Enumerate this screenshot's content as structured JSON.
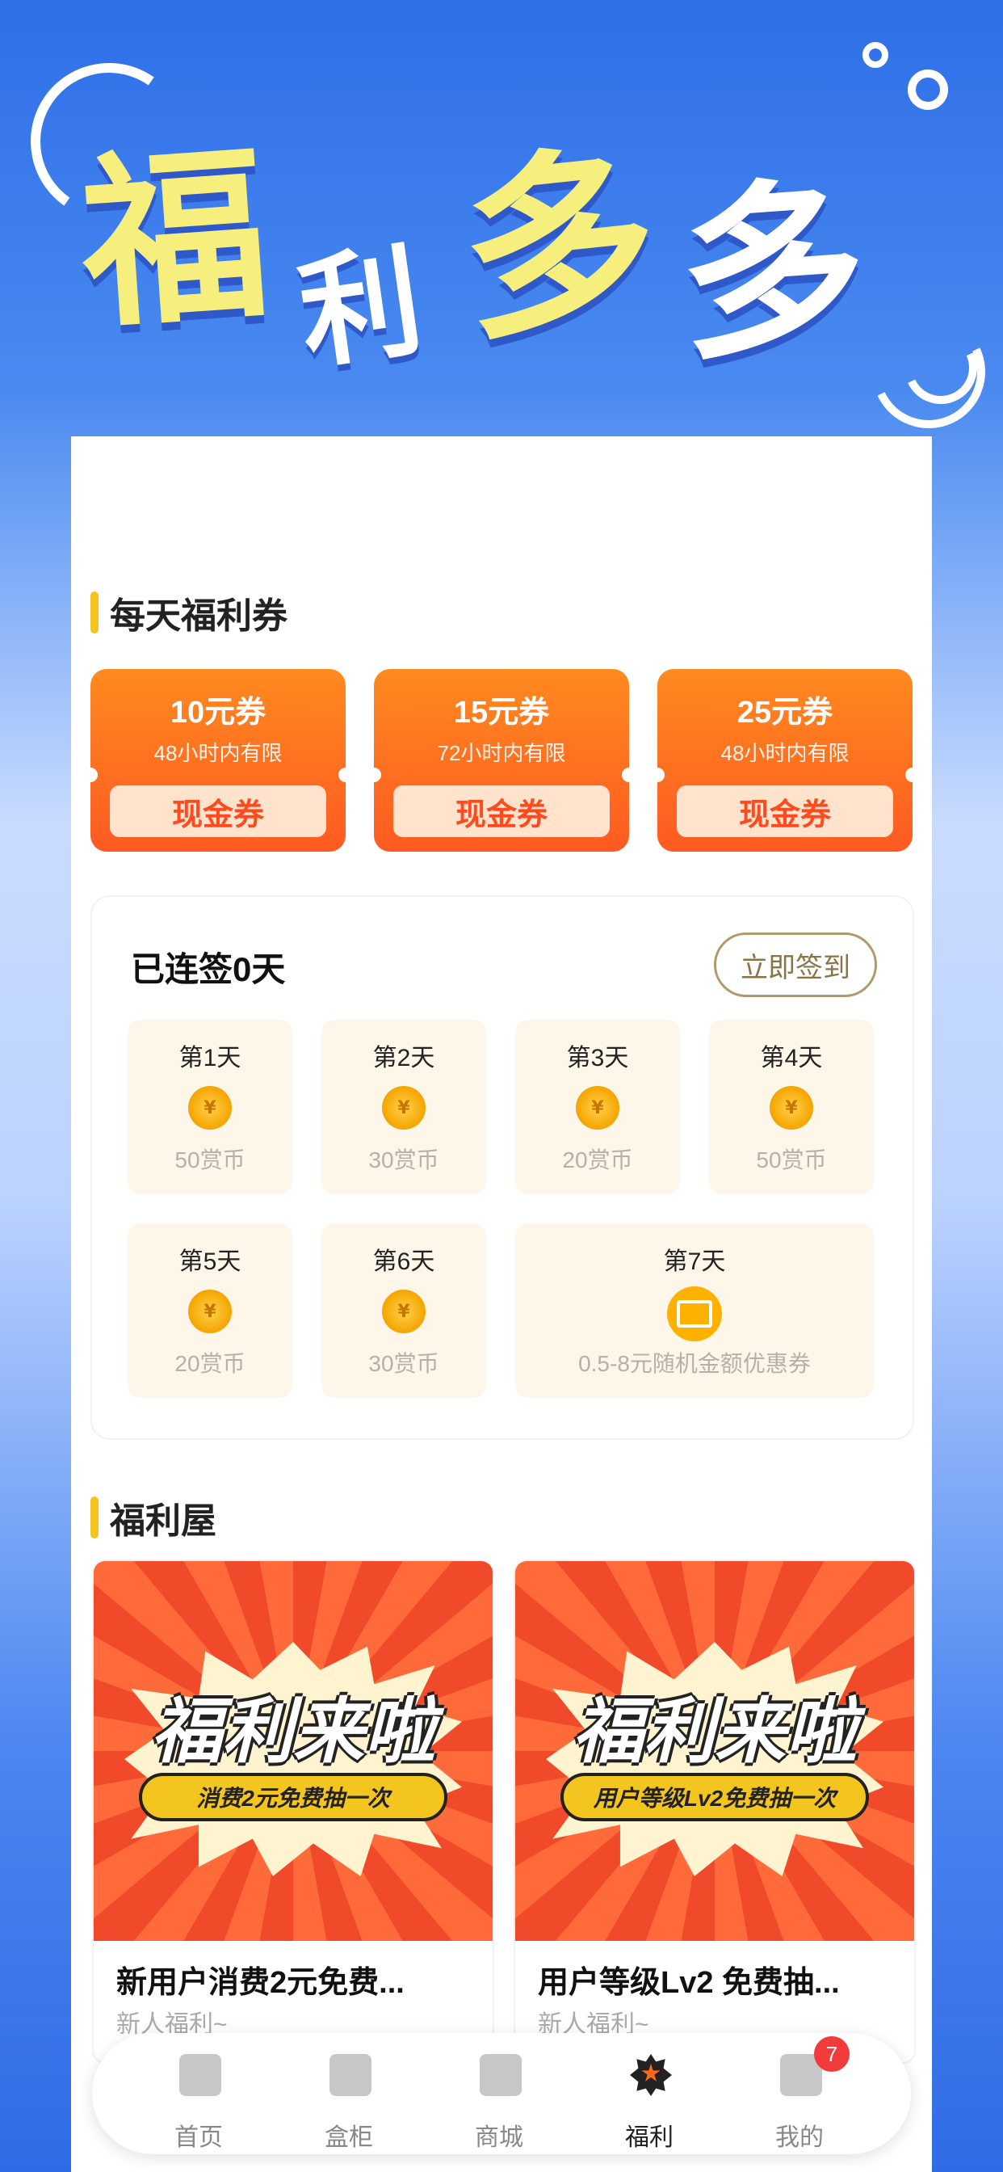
{
  "hero": {
    "chars": [
      "福",
      "利",
      "多",
      "多"
    ]
  },
  "daily_section": {
    "title": "每天福利券"
  },
  "coupons": [
    {
      "amount": "10元券",
      "limit": "48小时内有限",
      "type": "现金券"
    },
    {
      "amount": "15元券",
      "limit": "72小时内有限",
      "type": "现金券"
    },
    {
      "amount": "25元券",
      "limit": "48小时内有限",
      "type": "现金券"
    }
  ],
  "checkin": {
    "status": "已连签0天",
    "button": "立即签到",
    "days": [
      {
        "label": "第1天",
        "reward": "50赏币",
        "icon": "coin-icon"
      },
      {
        "label": "第2天",
        "reward": "30赏币",
        "icon": "coin-icon"
      },
      {
        "label": "第3天",
        "reward": "20赏币",
        "icon": "coin-icon"
      },
      {
        "label": "第4天",
        "reward": "50赏币",
        "icon": "coin-icon"
      },
      {
        "label": "第5天",
        "reward": "20赏币",
        "icon": "coin-icon"
      },
      {
        "label": "第6天",
        "reward": "30赏币",
        "icon": "coin-icon"
      },
      {
        "label": "第7天",
        "reward": "0.5-8元随机金额优惠券",
        "icon": "ticket-icon"
      }
    ]
  },
  "house_section": {
    "title": "福利屋"
  },
  "houses": [
    {
      "banner_title": "福利来啦",
      "banner_ribbon": "消费2元免费抽一次",
      "name": "新用户消费2元免费...",
      "sub": "新人福利~"
    },
    {
      "banner_title": "福利来啦",
      "banner_ribbon": "用户等级Lv2免费抽一次",
      "name": "用户等级Lv2 免费抽...",
      "sub": "新人福利~"
    }
  ],
  "tabbar": [
    {
      "label": "首页",
      "icon": "home-icon"
    },
    {
      "label": "盒柜",
      "icon": "cabinet-icon"
    },
    {
      "label": "商城",
      "icon": "shop-bag-icon"
    },
    {
      "label": "福利",
      "icon": "welfare-star-icon",
      "active": true
    },
    {
      "label": "我的",
      "icon": "profile-icon",
      "badge": "7"
    }
  ],
  "colors": {
    "accent": "#ff5a22",
    "gold": "#f5c51f",
    "bg_blue": "#2f6fe8"
  }
}
